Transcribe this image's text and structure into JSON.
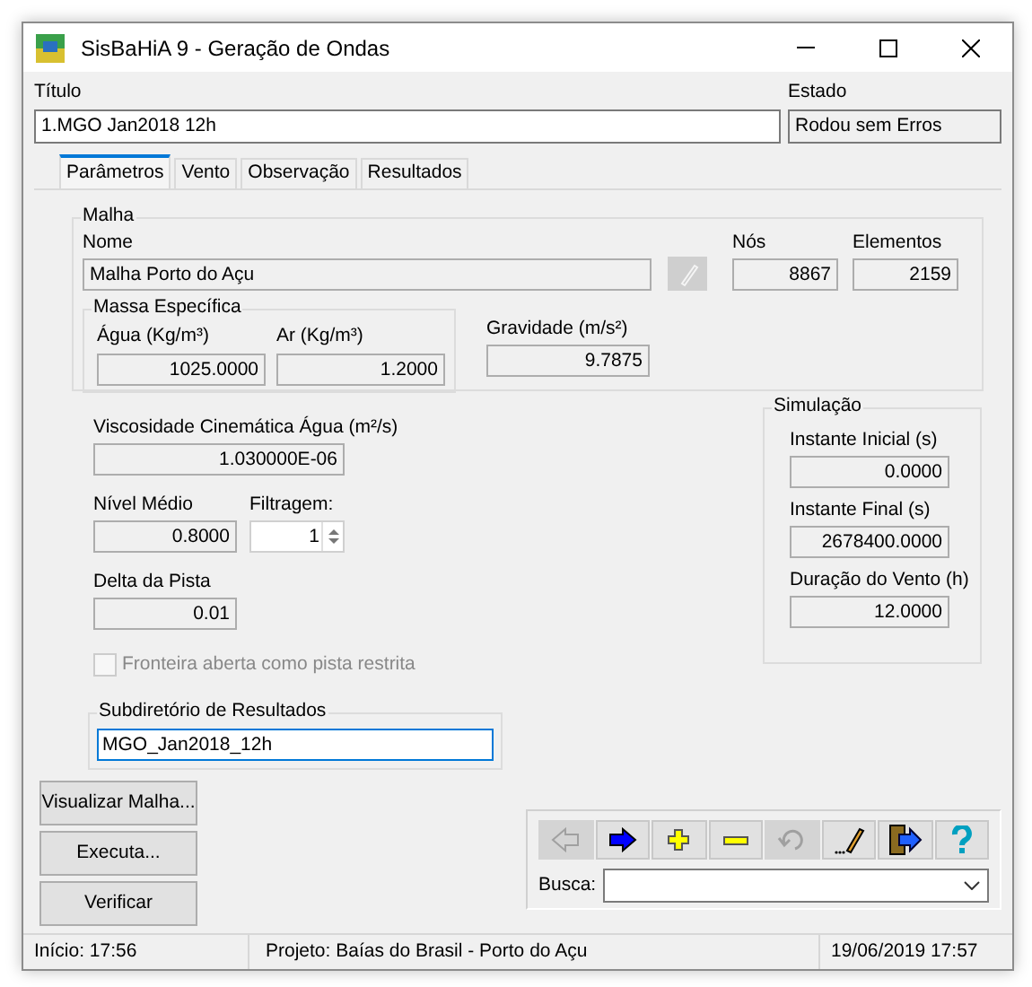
{
  "window": {
    "title": "SisBaHiA 9 - Geração de Ondas"
  },
  "titulo": {
    "label": "Título",
    "value": "1.MGO Jan2018 12h"
  },
  "estado": {
    "label": "Estado",
    "value": "Rodou sem Erros"
  },
  "tabs": [
    {
      "label": "Parâmetros",
      "selected": true
    },
    {
      "label": "Vento",
      "selected": false
    },
    {
      "label": "Observação",
      "selected": false
    },
    {
      "label": "Resultados",
      "selected": false
    }
  ],
  "malha": {
    "legend": "Malha",
    "nome": {
      "label": "Nome",
      "value": "Malha Porto do Açu"
    },
    "edit_button": {
      "disabled": true
    },
    "nos": {
      "label": "Nós",
      "value": "8867"
    },
    "elementos": {
      "label": "Elementos",
      "value": "2159"
    },
    "massa_especifica": {
      "legend": "Massa Específica",
      "agua": {
        "label": "Água (Kg/m³)",
        "value": "1025.0000"
      },
      "ar": {
        "label": "Ar (Kg/m³)",
        "value": "1.2000"
      }
    },
    "gravidade": {
      "label": "Gravidade (m/s²)",
      "value": "9.7875"
    }
  },
  "viscosidade": {
    "label": "Viscosidade Cinemática Água (m²/s)",
    "value": "1.030000E-06"
  },
  "nivel_medio": {
    "label": "Nível Médio",
    "value": "0.8000"
  },
  "filtragem": {
    "label": "Filtragem:",
    "value": "1"
  },
  "delta_pista": {
    "label": "Delta da Pista",
    "value": "0.01"
  },
  "fronteira_checkbox": {
    "label": "Fronteira aberta como pista restrita",
    "checked": false,
    "disabled": true
  },
  "subdiretorio": {
    "legend": "Subdiretório de Resultados",
    "value": "MGO_Jan2018_12h"
  },
  "simulacao": {
    "legend": "Simulação",
    "fields": [
      {
        "label": "Instante Inicial (s)",
        "value": "0.0000"
      },
      {
        "label": "Instante Final (s)",
        "value": "2678400.0000"
      },
      {
        "label": "Duração do Vento (h)",
        "value": "12.0000"
      }
    ]
  },
  "action_buttons": [
    "Visualizar Malha...",
    "Executa...",
    "Verificar"
  ],
  "toolbar": {
    "buttons": [
      {
        "kind": "back",
        "disabled": true
      },
      {
        "kind": "forward",
        "disabled": false
      },
      {
        "kind": "add",
        "disabled": false
      },
      {
        "kind": "remove",
        "disabled": false
      },
      {
        "kind": "undo",
        "disabled": true
      },
      {
        "kind": "edit",
        "disabled": false
      },
      {
        "kind": "exit",
        "disabled": false
      },
      {
        "kind": "help",
        "disabled": false
      }
    ],
    "busca": {
      "label": "Busca:"
    }
  },
  "status_bar": [
    "Início: 17:56",
    "Projeto: Baías do Brasil - Porto do Açu",
    "19/06/2019 17:57"
  ]
}
